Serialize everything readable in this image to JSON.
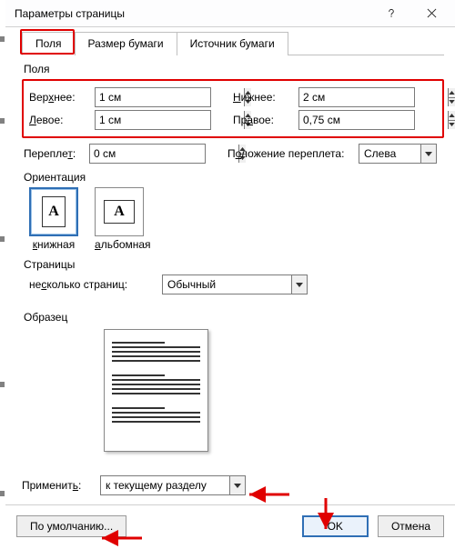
{
  "window": {
    "title": "Параметры страницы"
  },
  "tabs": {
    "fields": "Поля",
    "paper": "Размер бумаги",
    "source": "Источник бумаги"
  },
  "margins": {
    "heading": "Поля",
    "top_label": "Верхнее:",
    "top_value": "1 см",
    "bottom_label": "Нижнее:",
    "bottom_value": "2 см",
    "left_label": "Левое:",
    "left_value": "1 см",
    "right_label": "Правое:",
    "right_value": "0,75 см",
    "gutter_label": "Переплет:",
    "gutter_value": "0 см",
    "gutter_pos_label": "Положение переплета:",
    "gutter_pos_value": "Слева"
  },
  "orientation": {
    "heading": "Ориентация",
    "portrait": "книжная",
    "landscape": "альбомная",
    "glyph": "A"
  },
  "pages": {
    "heading": "Страницы",
    "multi_label": "несколько страниц:",
    "multi_value": "Обычный"
  },
  "sample": {
    "heading": "Образец"
  },
  "apply": {
    "label": "Применить:",
    "value": "к текущему разделу"
  },
  "footer": {
    "default": "По умолчанию...",
    "ok": "OK",
    "cancel": "Отмена"
  }
}
